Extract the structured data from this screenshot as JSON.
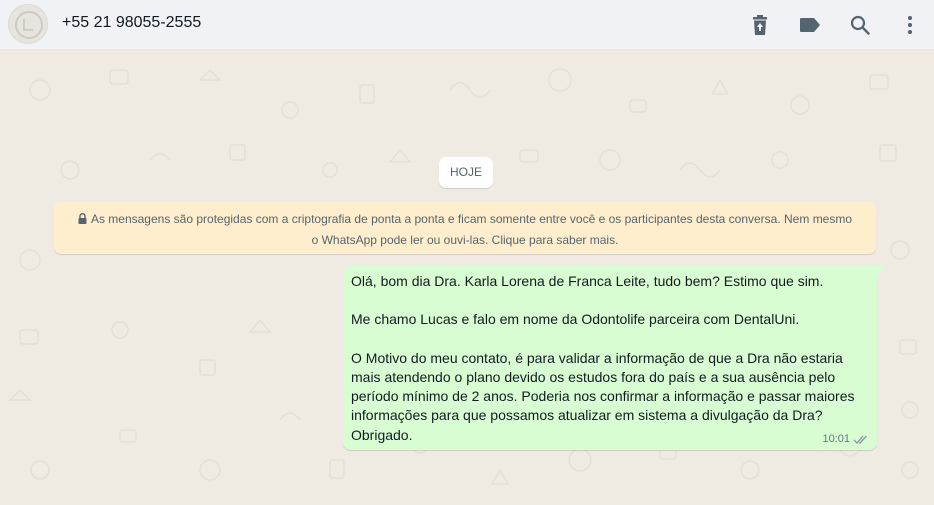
{
  "header": {
    "contact_name": "+55 21 98055-2555",
    "actions": [
      {
        "name": "delete-chat-icon"
      },
      {
        "name": "label-icon"
      },
      {
        "name": "search-icon"
      },
      {
        "name": "menu-icon"
      }
    ]
  },
  "chat": {
    "date_separator": "HOJE",
    "encryption_notice_line1": "As mensagens são protegidas com a criptografia de ponta a ponta e ficam somente entre você e os participantes desta conversa. Nem mesmo",
    "encryption_notice_line2": "o WhatsApp pode ler ou ouvi-las. Clique para saber mais.",
    "messages": [
      {
        "direction": "outgoing",
        "text": "Olá, bom dia Dra. Karla Lorena de Franca Leite, tudo bem? Estimo que sim.\n\nMe chamo Lucas e falo em nome da Odontolife parceira com DentalUni.\n\nO Motivo do meu contato, é para validar a informação de que a Dra não estaria\nmais atendendo o plano devido os estudos fora do país e a sua ausência pelo\nperíodo mínimo de 2 anos. Poderia nos confirmar a informação e passar maiores\ninformações para que possamos atualizar em sistema a divulgação da Dra?\nObrigado.",
        "time": "10:01",
        "status": "read"
      }
    ]
  },
  "colors": {
    "header_bg": "#f0f2f5",
    "chat_bg": "#efeae2",
    "outgoing_bubble": "#d9fdd3",
    "encryption_banner": "#ffeecd",
    "icon_gray": "#54656f",
    "text_primary": "#111b21",
    "read_ticks": "#8696a0"
  }
}
